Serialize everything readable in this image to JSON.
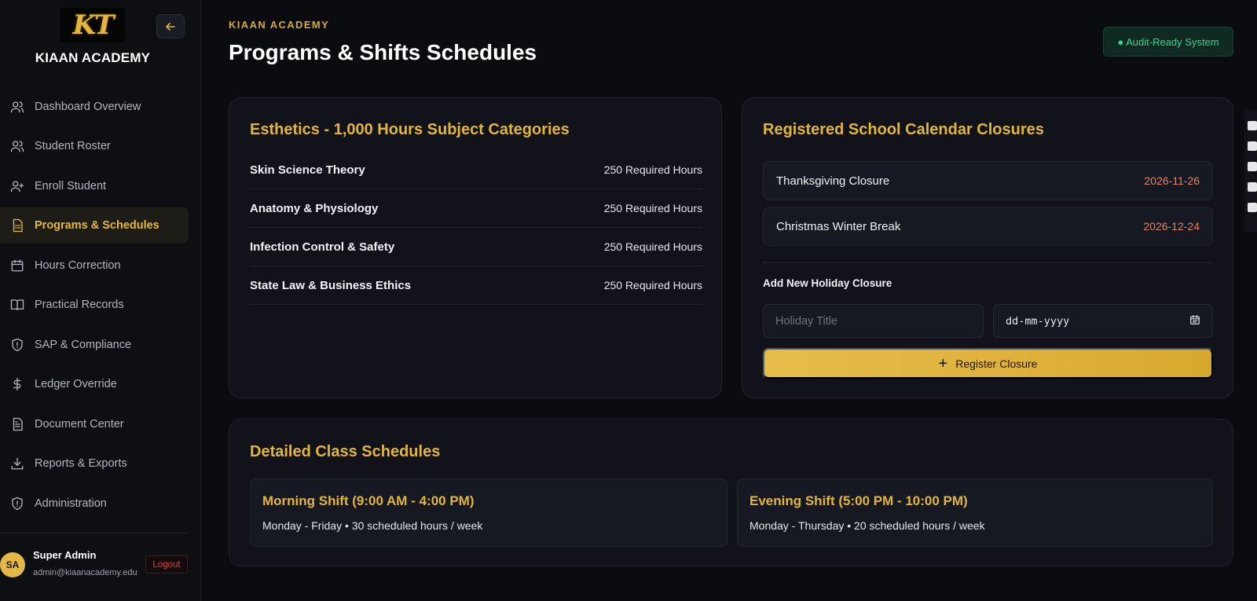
{
  "sidebar": {
    "logo_text": "KT",
    "brand": "KIAAN ACADEMY",
    "items": [
      {
        "label": "Dashboard Overview",
        "icon": "users-icon"
      },
      {
        "label": "Student Roster",
        "icon": "users-icon"
      },
      {
        "label": "Enroll Student",
        "icon": "user-plus-icon"
      },
      {
        "label": "Programs & Schedules",
        "icon": "document-list-icon",
        "active": true
      },
      {
        "label": "Hours Correction",
        "icon": "calendar-icon"
      },
      {
        "label": "Practical Records",
        "icon": "book-icon"
      },
      {
        "label": "SAP & Compliance",
        "icon": "shield-alert-icon"
      },
      {
        "label": "Ledger Override",
        "icon": "dollar-icon"
      },
      {
        "label": "Document Center",
        "icon": "file-text-icon"
      },
      {
        "label": "Reports & Exports",
        "icon": "download-icon"
      },
      {
        "label": "Administration",
        "icon": "shield-alert-icon"
      }
    ],
    "user": {
      "initials": "SA",
      "name": "Super Admin",
      "email": "admin@kiaanacademy.edu",
      "logout_label": "Logout"
    }
  },
  "header": {
    "eyebrow": "KIAAN ACADEMY",
    "title": "Programs & Shifts Schedules",
    "badge": "● Audit-Ready System"
  },
  "subjects": {
    "title": "Esthetics - 1,000 Hours Subject Categories",
    "rows": [
      {
        "name": "Skin Science Theory",
        "hours": "250 Required Hours"
      },
      {
        "name": "Anatomy & Physiology",
        "hours": "250 Required Hours"
      },
      {
        "name": "Infection Control & Safety",
        "hours": "250 Required Hours"
      },
      {
        "name": "State Law & Business Ethics",
        "hours": "250 Required Hours"
      }
    ]
  },
  "closures": {
    "title": "Registered School Calendar Closures",
    "rows": [
      {
        "name": "Thanksgiving Closure",
        "date": "2026-11-26"
      },
      {
        "name": "Christmas Winter Break",
        "date": "2026-12-24"
      }
    ],
    "add_label": "Add New Holiday Closure",
    "title_placeholder": "Holiday Title",
    "date_placeholder": "dd-mm-yyyy",
    "register_label": "Register Closure"
  },
  "schedules": {
    "title": "Detailed Class Schedules",
    "shifts": [
      {
        "title": "Morning Shift (9:00 AM - 4:00 PM)",
        "desc": "Monday - Friday • 30 scheduled hours / week"
      },
      {
        "title": "Evening Shift (5:00 PM - 10:00 PM)",
        "desc": "Monday - Thursday • 20 scheduled hours / week"
      }
    ]
  },
  "colors": {
    "accent": "#e2b53f",
    "background": "#0b0c10",
    "success": "#3fd18e",
    "danger": "#e0433f"
  }
}
